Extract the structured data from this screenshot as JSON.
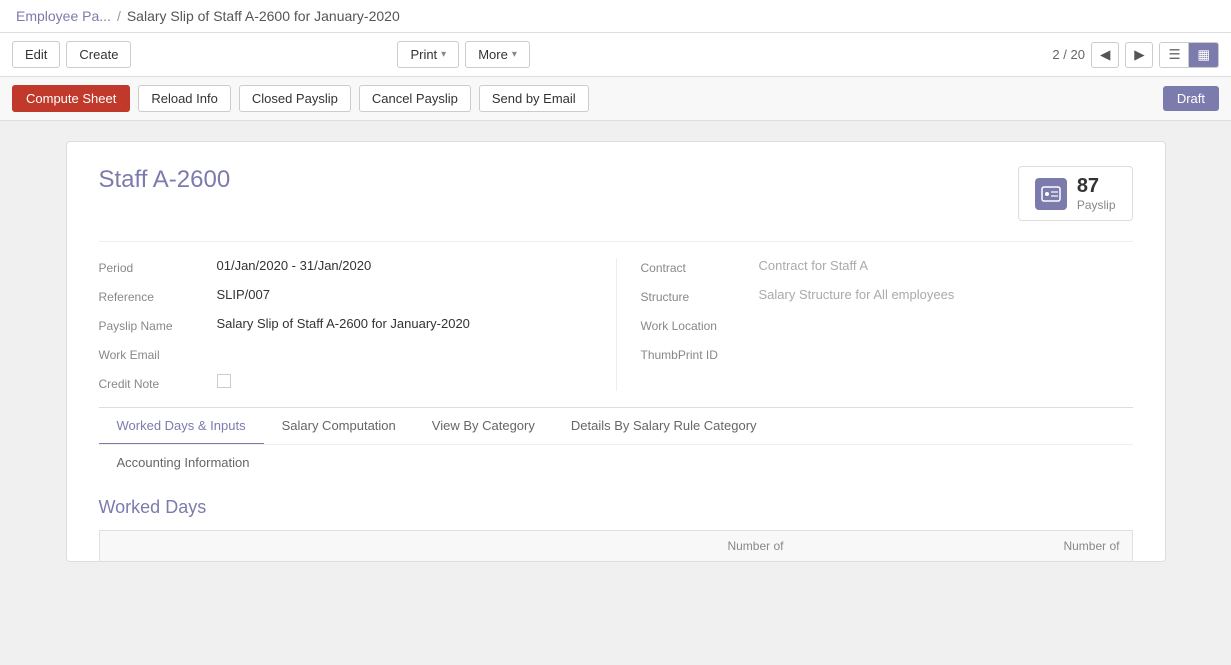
{
  "breadcrumb": {
    "parent_label": "Employee Pa...",
    "separator": "/",
    "current_label": "Salary Slip of Staff A-2600 for January-2020"
  },
  "toolbar": {
    "edit_label": "Edit",
    "create_label": "Create",
    "print_label": "Print",
    "more_label": "More",
    "pagination": {
      "current": 2,
      "total": 20,
      "display": "2 / 20"
    },
    "view_list_icon": "☰",
    "view_grid_icon": "▦"
  },
  "action_bar": {
    "compute_sheet_label": "Compute Sheet",
    "reload_info_label": "Reload Info",
    "closed_payslip_label": "Closed Payslip",
    "cancel_payslip_label": "Cancel Payslip",
    "send_by_email_label": "Send by Email",
    "status_label": "Draft"
  },
  "form": {
    "staff_name": "Staff A-2600",
    "payslip_count": "87",
    "payslip_count_label": "Payslip",
    "fields": {
      "period_label": "Period",
      "period_value": "01/Jan/2020 - 31/Jan/2020",
      "reference_label": "Reference",
      "reference_value": "SLIP/007",
      "payslip_name_label": "Payslip Name",
      "payslip_name_value": "Salary Slip of Staff A-2600 for January-2020",
      "work_email_label": "Work Email",
      "work_email_value": "",
      "credit_note_label": "Credit Note",
      "contract_label": "Contract",
      "contract_value": "Contract for Staff A",
      "structure_label": "Structure",
      "structure_value": "Salary Structure for All employees",
      "work_location_label": "Work Location",
      "work_location_value": "",
      "thumbprint_id_label": "ThumbPrint ID",
      "thumbprint_id_value": ""
    }
  },
  "tabs": [
    {
      "id": "worked-days",
      "label": "Worked Days & Inputs",
      "active": true
    },
    {
      "id": "salary-computation",
      "label": "Salary Computation",
      "active": false
    },
    {
      "id": "view-by-category",
      "label": "View By Category",
      "active": false
    },
    {
      "id": "details-by-salary",
      "label": "Details By Salary Rule Category",
      "active": false
    },
    {
      "id": "accounting-info",
      "label": "Accounting Information",
      "active": false
    }
  ],
  "worked_days": {
    "section_title": "Worked Days",
    "table_headers": {
      "description": "",
      "number_of_col1": "Number of",
      "number_of_col2": "Number of"
    }
  }
}
